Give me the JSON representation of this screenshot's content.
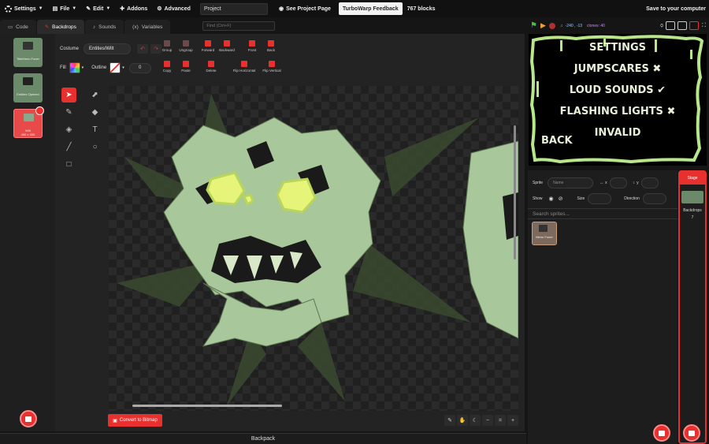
{
  "menubar": {
    "settings": "Settings",
    "file": "File",
    "edit": "Edit",
    "addons": "Addons",
    "advanced": "Advanced",
    "project_title": "Project",
    "see_project_page": "See Project Page",
    "feedback": "TurboWarp Feedback",
    "blocks_count": "767 blocks",
    "save": "Save to your computer"
  },
  "tabs": [
    {
      "label": "Code"
    },
    {
      "label": "Backdrops"
    },
    {
      "label": "Sounds"
    },
    {
      "label": "Variables"
    }
  ],
  "find_placeholder": "Find (Ctrl+F)",
  "costumes": [
    {
      "name": "TitleMenu Foner"
    },
    {
      "name": "Entities Opened"
    },
    {
      "name": "Wilt",
      "size": "450 x 305"
    }
  ],
  "paint": {
    "costume_label": "Costume",
    "costume_name": "Entities/Wilt",
    "fill_label": "Fill",
    "outline_label": "Outline",
    "outline_width": "0",
    "actions": [
      "Group",
      "Ungroup",
      "Forward",
      "Backward",
      "Front",
      "Back"
    ],
    "actions2": [
      "Copy",
      "Paste",
      "Delete",
      "Flip Horizontal",
      "Flip Vertical"
    ],
    "convert": "Convert to Bitmap",
    "zoom_reset": "="
  },
  "backpack": "Backpack",
  "stage": {
    "coords": "-240 , -13",
    "clones": "clones: 40",
    "menu": [
      "SETTINGS",
      "JUMPSCARES ✖",
      "LOUD SOUNDS ✔",
      "FLASHING LIGHTS ✖",
      "INVALID",
      "BACK"
    ]
  },
  "sprite_info": {
    "sprite_label": "Sprite",
    "name_placeholder": "Name",
    "x_label": "x",
    "y_label": "y",
    "show_label": "Show",
    "size_label": "Size",
    "direction_label": "Direction",
    "search_placeholder": "Search sprites...",
    "sprite_thumb": "Menu Foner"
  },
  "stage_panel": {
    "title": "Stage",
    "backdrops_label": "Backdrops",
    "backdrops_count": "7"
  },
  "colors": {
    "accent": "#e8302f",
    "monster": "#a8c79a",
    "eyes": "#e6f57a",
    "slime": "#b8e68a"
  }
}
